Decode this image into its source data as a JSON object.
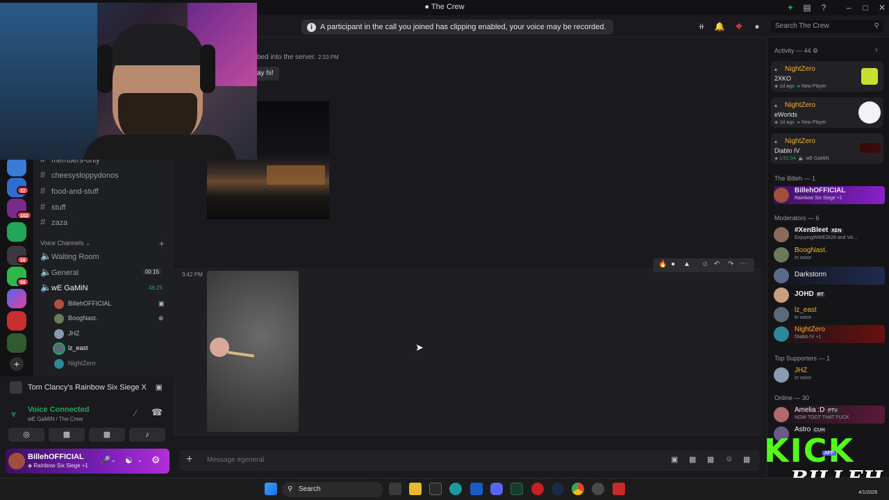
{
  "window": {
    "title": "The Crew"
  },
  "notice": "A participant in the call you joined has clipping enabled, your voice may be recorded.",
  "search": {
    "placeholder": "Search The Crew"
  },
  "servers": [
    {
      "badge": "32"
    },
    {
      "badge": "102"
    },
    {
      "badge": "16"
    },
    {
      "badge": "55"
    }
  ],
  "channels": {
    "text": [
      "members-only",
      "cheesysloppydonos",
      "food-and-stuff",
      "stuff",
      "zaza"
    ],
    "voice_header": "Voice Channels",
    "voice": [
      {
        "name": "Waiting Room",
        "meta": ""
      },
      {
        "name": "General",
        "meta": "00 15"
      },
      {
        "name": "wE GaMiN",
        "meta": "46:25"
      }
    ],
    "voice_users": [
      "BillehOFFICIAL",
      "BoogNast.",
      "JHZ",
      "lz_east",
      "NightZero"
    ]
  },
  "game_activity": "Tom Clancy's Rainbow Six Siege X",
  "voice_status": {
    "title": "Voice Connected",
    "sub": "wE GaMiN / The Crew"
  },
  "user": {
    "name": "BillehOFFICIAL",
    "status": "Rainbow Six Siege +1"
  },
  "chat": {
    "system_msg": "bed into the server.",
    "system_time": "2:33 PM",
    "say_hi": "ay hi!",
    "msg_time": "3:42 PM",
    "composer_placeholder": "Message #general"
  },
  "activity": {
    "header": "Activity — 44",
    "items": [
      {
        "user": "NightZero",
        "game": "2XKO",
        "meta": "1d ago",
        "tag": "New Player"
      },
      {
        "user": "NightZero",
        "game": "eWorlds",
        "meta": "1d ago",
        "tag": "New Player"
      },
      {
        "user": "NightZero",
        "game": "Diablo IV",
        "meta": "1:51:54",
        "tag": "wE GaMiN"
      }
    ]
  },
  "members": {
    "owner_header": "The Billeh — 1",
    "owner": [
      {
        "name": "BillehOFFICIAL",
        "status": "Rainbow Six Siege +1"
      }
    ],
    "mod_header": "Moderators — 6",
    "mods": [
      {
        "name": "#XenBleet",
        "tag": "XEN",
        "status": "EnjoyingWWE2k26 and VA..."
      },
      {
        "name": "BoogNast.",
        "tag": "",
        "status": "In voice"
      },
      {
        "name": "Darkstorm",
        "tag": "",
        "status": ""
      },
      {
        "name": "JOHD",
        "tag": "RT",
        "status": ""
      },
      {
        "name": "lz_east",
        "tag": "",
        "status": "In voice"
      },
      {
        "name": "NightZero",
        "tag": "",
        "status": "Diablo IV +1"
      }
    ],
    "support_header": "Top Supporters — 1",
    "supporters": [
      {
        "name": "JHZ",
        "status": "In voice"
      }
    ],
    "online_header": "Online — 30",
    "online": [
      {
        "name": "Amelia :D",
        "tag": "PTV",
        "status": "NOW TOOT THAT FUCK"
      },
      {
        "name": "Astro",
        "tag": "CUH",
        "status": ""
      }
    ]
  },
  "taskbar": {
    "search": "Search",
    "date": "4/1/2026"
  },
  "overlay": {
    "kick_line1": "KICK",
    "kick_line2": "BILLEH",
    "kick_badge": "APP"
  },
  "colors": {
    "accent": "#5865f2",
    "voice_green": "#23a55a",
    "mod_gold": "#f0b232",
    "badge_red": "#f23f43"
  }
}
